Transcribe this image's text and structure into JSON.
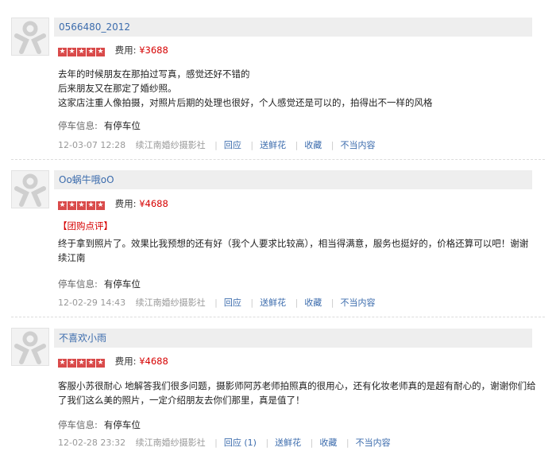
{
  "reviews": [
    {
      "username": "0566480_2012",
      "fee_label": "费用:",
      "fee_value": "¥3688",
      "tag": "",
      "content_lines": [
        "去年的时候朋友在那拍过写真，感觉还好不错的",
        "后来朋友又在那定了婚纱照。",
        "这家店注重人像拍摄，对照片后期的处理也很好，个人感觉还是可以的，拍得出不一样的风格"
      ],
      "parking_label": "停车信息:",
      "parking_value": "有停车位",
      "date": "12-03-07 12:28",
      "shop": "续江南婚纱摄影社",
      "actions": [
        "回应",
        "送鲜花",
        "收藏",
        "不当内容"
      ]
    },
    {
      "username": "Oo蜗牛哦oO",
      "fee_label": "费用:",
      "fee_value": "¥4688",
      "tag": "【团购点评】",
      "content_lines": [
        "终于拿到照片了。效果比我预想的还有好（我个人要求比较高），相当得满意，服务也挺好的，价格还算可以吧！谢谢",
        "续江南"
      ],
      "parking_label": "停车信息:",
      "parking_value": "有停车位",
      "date": "12-02-29 14:43",
      "shop": "续江南婚纱摄影社",
      "actions": [
        "回应",
        "送鲜花",
        "收藏",
        "不当内容"
      ]
    },
    {
      "username": "不喜欢小雨",
      "fee_label": "费用:",
      "fee_value": "¥4688",
      "tag": "",
      "content_lines": [
        "客服小苏很耐心 地解答我们很多问题，摄影师阿苏老师拍照真的很用心，还有化妆老师真的是超有耐心的，谢谢你们给",
        "了我们这么美的照片，一定介绍朋友去你们那里，真是值了！"
      ],
      "parking_label": "停车信息:",
      "parking_value": "有停车位",
      "date": "12-02-28 23:32",
      "shop": "续江南婚纱摄影社",
      "actions": [
        "回应 (1)",
        "送鲜花",
        "收藏",
        "不当内容"
      ]
    }
  ],
  "icons": {
    "avatar": "default-user-icon",
    "star": "star-icon"
  },
  "colors": {
    "link": "#3c6cad",
    "price": "#d60000",
    "star": "#d94a4a",
    "bar": "#eeeeee"
  }
}
